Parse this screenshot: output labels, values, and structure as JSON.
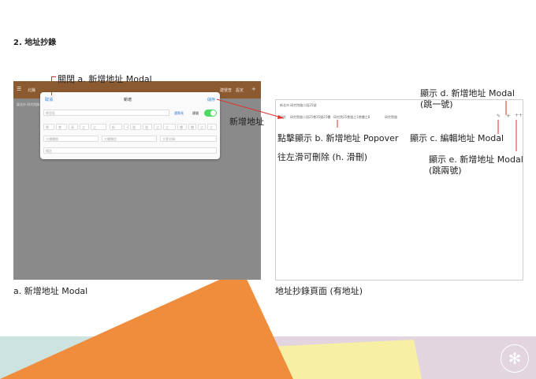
{
  "page": {
    "heading": "2. 地址抄錄",
    "caption_left": "a. 新增地址 Modal",
    "caption_right": "地址抄錄頁面 (有地址)"
  },
  "annotations": {
    "close": "關閉 a. 新增地址 Modal",
    "add_address": "新增地址",
    "jump1_line1": "顯示 d. 新增地址 Modal",
    "jump1_line2": "(跳一號)",
    "popover": "點擊顯示 b. 新增地址 Popover",
    "swipe": "往左滑可刪除 (h. 滑刪)",
    "edit": "顯示 c. 編輯地址 Modal",
    "jump2_line1": "顯示 e. 新增地址 Modal",
    "jump2_line2": "(跳兩號)"
  },
  "left_screen": {
    "nav_title": "北縣",
    "nav_items": [
      "建號查",
      "設定"
    ],
    "subtitle": "臺北市 研究院路二段25號",
    "modal": {
      "cancel": "取消",
      "title": "新增",
      "save": "儲存",
      "row1_placeholder": "鄰里區",
      "row1_link": "選鄰長",
      "row1_toggle_label": "連號",
      "row2_fields": [
        "鄰",
        "巷",
        "弄",
        "之",
        "之",
        "街",
        "~",
        "號",
        "號",
        "之",
        "之",
        "樓",
        "樓",
        "之",
        "之"
      ],
      "row3_fields": [
        "大樓樓號",
        "大樓類型",
        "大廈名稱"
      ],
      "row4_placeholder": "備註"
    }
  },
  "right_screen": {
    "header": "新北市 研究院路二段25號",
    "row_label": "研究",
    "row_text": "研究院路二段25巷35號25樓 · 研究院25巷號之1巷樓之8",
    "row_extra": "研究院路"
  }
}
